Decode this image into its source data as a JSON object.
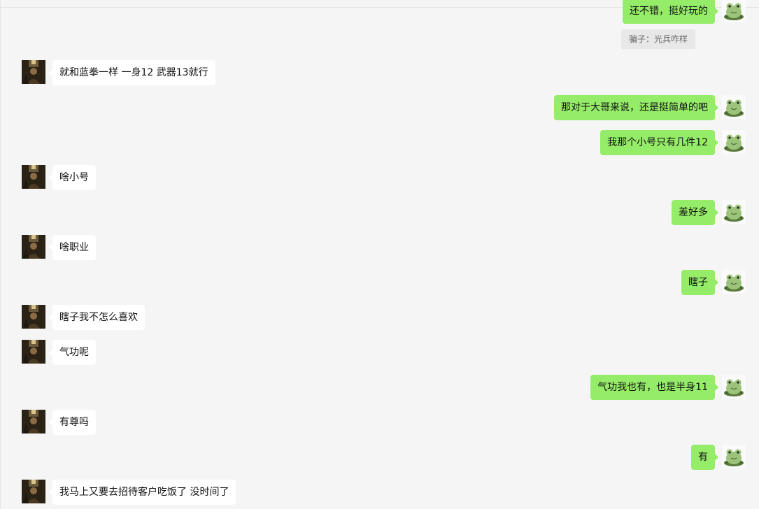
{
  "colors": {
    "background": "#f5f5f5",
    "self_bubble": "#95ec69",
    "other_bubble": "#ffffff",
    "quote_bg": "#e8e8e8"
  },
  "messages": [
    {
      "sender": "self",
      "text": "还不错，挺好玩的"
    },
    {
      "sender": "other",
      "text": "就和蓝拳一样 一身12 武器13就行"
    },
    {
      "sender": "self",
      "text": "那对于大哥来说，还是挺简单的吧"
    },
    {
      "sender": "self",
      "text": "我那个小号只有几件12"
    },
    {
      "sender": "other",
      "text": "啥小号"
    },
    {
      "sender": "self",
      "text": "差好多"
    },
    {
      "sender": "other",
      "text": "啥职业"
    },
    {
      "sender": "self",
      "text": "瞎子"
    },
    {
      "sender": "other",
      "text": "瞎子我不怎么喜欢"
    },
    {
      "sender": "other",
      "text": "气功呢"
    },
    {
      "sender": "self",
      "text": "气功我也有，也是半身11"
    },
    {
      "sender": "other",
      "text": "有尊吗"
    },
    {
      "sender": "self",
      "text": "有"
    },
    {
      "sender": "other",
      "text": "我马上又要去招待客户吃饭了  没时间了"
    }
  ],
  "quote": {
    "text": "骗子：光兵咋样"
  },
  "icons": {
    "other_avatar": "person-photo-avatar",
    "self_avatar": "frog-avatar"
  }
}
